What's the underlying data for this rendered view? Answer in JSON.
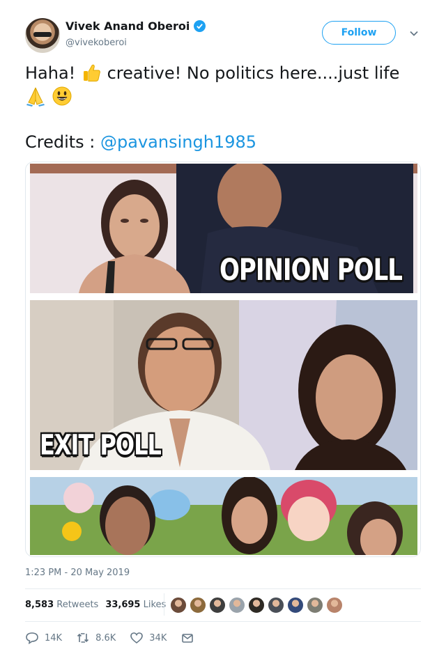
{
  "author": {
    "display_name": "Vivek Anand Oberoi",
    "handle": "@vivekoberoi",
    "verified": true,
    "follow_label": "Follow"
  },
  "tweet": {
    "text_part1": "Haha! ",
    "text_part2": " creative! No politics here....just life",
    "credits_label": "Credits : ",
    "mention": "@pavansingh1985",
    "emoji": [
      "thumbs-up",
      "folded-hands",
      "smiling-face"
    ]
  },
  "media": {
    "panels": [
      {
        "caption": "OPINION POLL"
      },
      {
        "caption": "EXIT POLL"
      },
      {
        "caption": ""
      }
    ]
  },
  "meta": {
    "timestamp": "1:23 PM - 20 May 2019"
  },
  "stats": {
    "retweets_count": "8,583",
    "retweets_label": "Retweets",
    "likes_count": "33,695",
    "likes_label": "Likes",
    "liker_avatar_colors": [
      "#6b4b3a",
      "#8c6a3c",
      "#3e3e3e",
      "#9aa3ab",
      "#2e2a24",
      "#4a4f57",
      "#334a7a",
      "#7d7d73",
      "#b8836a"
    ]
  },
  "actions": {
    "reply_count": "14K",
    "retweet_count": "8.6K",
    "like_count": "34K"
  },
  "colors": {
    "twitter_blue": "#1da1f2",
    "link_blue": "#1b95e0",
    "secondary_text": "#657786"
  }
}
